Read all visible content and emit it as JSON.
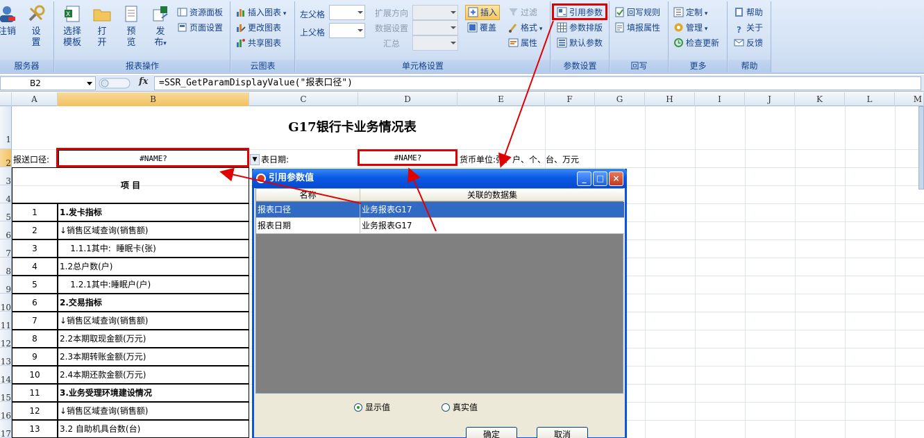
{
  "ribbon": {
    "groups": [
      {
        "label": "服务器"
      },
      {
        "label": "报表操作"
      },
      {
        "label": "云图表"
      },
      {
        "label": "单元格设置"
      },
      {
        "label": "参数设置"
      },
      {
        "label": "回写"
      },
      {
        "label": "更多"
      },
      {
        "label": "帮助"
      }
    ],
    "server": {
      "logout": "注销",
      "settings_1": "设",
      "settings_2": "置"
    },
    "report": {
      "select_1": "选择",
      "select_2": "模板",
      "open_1": "打",
      "open_2": "开",
      "preview_1": "预",
      "preview_2": "览",
      "publish_1": "发",
      "publish_2": "布",
      "resource_panel": "资源面板",
      "page_setup": "页面设置"
    },
    "cloud": {
      "insert_chart": "插入图表",
      "edit_chart": "更改图表",
      "share_chart": "共享图表"
    },
    "cell": {
      "left_parent": "左父格",
      "top_parent": "上父格",
      "expand_dir": "扩展方向",
      "data_setting": "数据设置",
      "summary": "汇总",
      "insert": "插入",
      "cover": "覆盖",
      "filter": "过滤",
      "format": "格式",
      "property": "属性"
    },
    "param": {
      "ref_param": "引用参数",
      "param_layout": "参数排版",
      "default_param": "默认参数"
    },
    "writeback": {
      "rule": "回写规则",
      "fill_prop": "填报属性"
    },
    "more": {
      "custom": "定制",
      "manage": "管理",
      "check_update": "检查更新"
    },
    "help": {
      "help": "帮助",
      "about": "关于",
      "feedback": "反馈"
    }
  },
  "formula_bar": {
    "cell_ref": "B2",
    "fx": "fx",
    "formula": "=SSR_GetParamDisplayValue(\"报表口径\")"
  },
  "grid": {
    "columns": [
      "A",
      "B",
      "C",
      "D",
      "E",
      "F",
      "G",
      "H",
      "I",
      "J",
      "K",
      "L",
      "M"
    ],
    "rows": [
      "1",
      "2",
      "3",
      "4",
      "5",
      "6",
      "7",
      "8",
      "9",
      "10",
      "11",
      "12",
      "13",
      "14",
      "15",
      "16",
      "17"
    ],
    "title": "G17银行卡业务情况表",
    "report_scope_label": "报送口径:",
    "report_scope_value": "#NAME?",
    "report_date_label": "表日期:",
    "report_date_value": "#NAME?",
    "currency_label": "货币单位:张、户、个、台、万元",
    "item_header": "项                    目",
    "items": [
      {
        "no": "1",
        "name": "1.发卡指标",
        "bold": true
      },
      {
        "no": "2",
        "name": "↓销售区域查询(销售额)",
        "bold": false
      },
      {
        "no": "3",
        "name": "    1.1.1其中:  睡眠卡(张)",
        "bold": false
      },
      {
        "no": "4",
        "name": "1.2总户数(户)",
        "bold": false
      },
      {
        "no": "5",
        "name": "    1.2.1其中:睡眠户(户)",
        "bold": false
      },
      {
        "no": "6",
        "name": "2.交易指标",
        "bold": true
      },
      {
        "no": "7",
        "name": "↓销售区域查询(销售额)",
        "bold": false
      },
      {
        "no": "8",
        "name": "2.2本期取现金额(万元)",
        "bold": false
      },
      {
        "no": "9",
        "name": "2.3本期转账金额(万元)",
        "bold": false
      },
      {
        "no": "10",
        "name": "2.4本期还款金额(万元)",
        "bold": false
      },
      {
        "no": "11",
        "name": "3.业务受理环境建设情况",
        "bold": true
      },
      {
        "no": "12",
        "name": "↓销售区域查询(销售额)",
        "bold": false
      },
      {
        "no": "13",
        "name": "3.2 自助机具台数(台)",
        "bold": false
      }
    ]
  },
  "dialog": {
    "title": "引用参数值",
    "col_name": "名称",
    "col_dataset": "关联的数据集",
    "rows": [
      {
        "name": "报表口径",
        "dataset": "业务报表G17",
        "selected": true
      },
      {
        "name": "报表日期",
        "dataset": "业务报表G17",
        "selected": false
      }
    ],
    "radio_display": "显示值",
    "radio_real": "真实值",
    "ok": "确定",
    "cancel": "取消",
    "min": "_",
    "max": "□",
    "close": "×"
  },
  "colors": {
    "highlight": "#e00000",
    "selection": "#316ac5",
    "title_bar": "#0a5ae6"
  }
}
